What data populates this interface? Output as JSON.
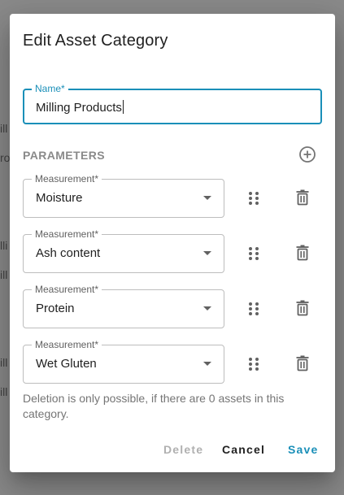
{
  "backdrop": {
    "fragments": [
      "ill",
      "ro",
      "lli",
      "ill",
      "ill",
      "ill"
    ]
  },
  "dialog": {
    "title": "Edit Asset Category",
    "name_field": {
      "label": "Name*",
      "value": "Milling Products"
    },
    "parameters": {
      "section_title": "PARAMETERS",
      "add_icon": "add-circle-outline-icon",
      "items": [
        {
          "label": "Measurement*",
          "value": "Moisture"
        },
        {
          "label": "Measurement*",
          "value": "Ash content"
        },
        {
          "label": "Measurement*",
          "value": "Protein"
        },
        {
          "label": "Measurement*",
          "value": "Wet Gluten"
        }
      ]
    },
    "hint": "Deletion is only possible, if there are 0 assets in this category.",
    "actions": {
      "delete": "Delete",
      "cancel": "Cancel",
      "save": "Save"
    }
  },
  "colors": {
    "accent": "#1a8fb8",
    "backdrop": "#8a8a8a",
    "disabled": "#b0b0b0"
  }
}
